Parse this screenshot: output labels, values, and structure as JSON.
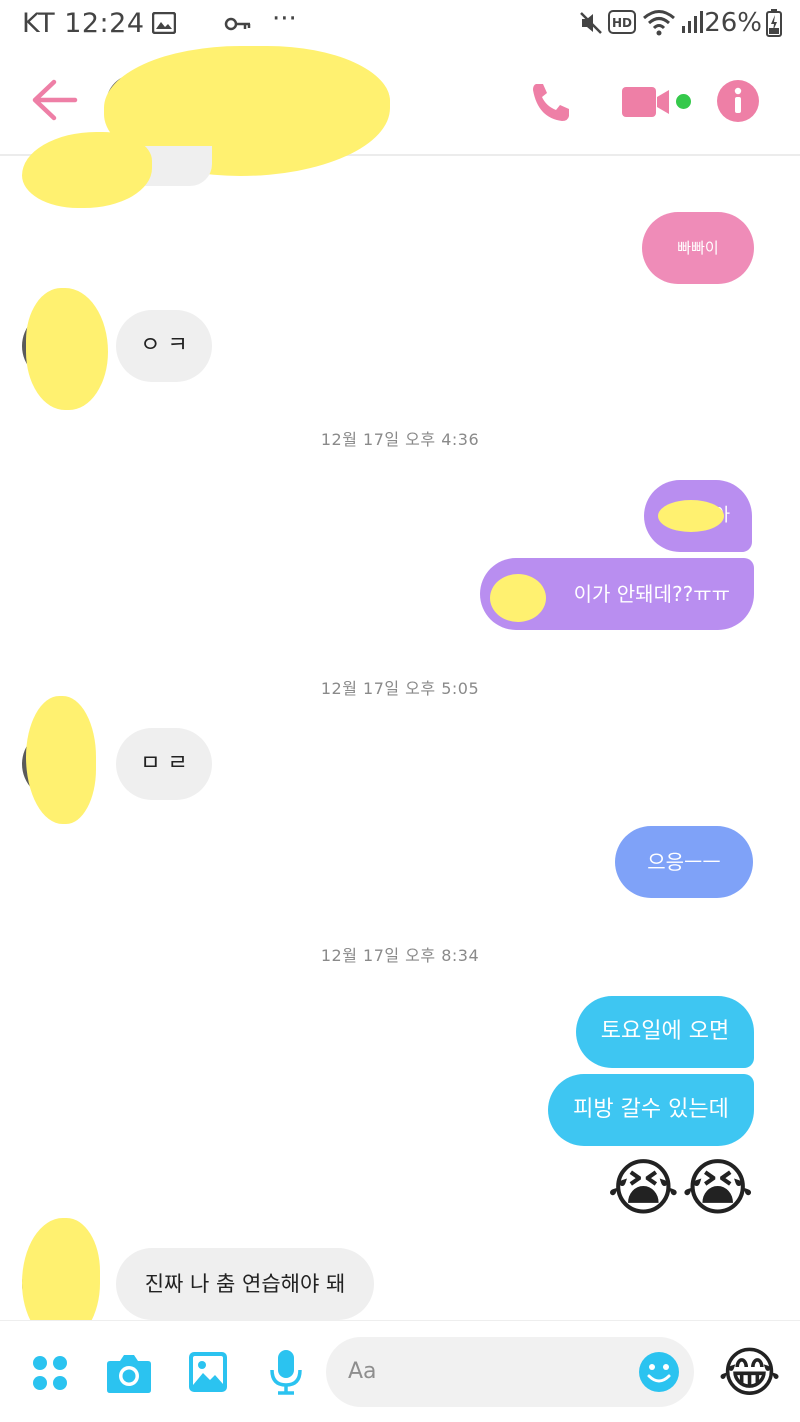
{
  "status_bar": {
    "carrier": "KT",
    "time": "12:24",
    "overflow": "···",
    "battery": "26%",
    "icons": [
      "image-icon",
      "key-icon",
      "mute-icon",
      "hd-icon",
      "wifi-icon",
      "signal-icon",
      "battery-icon"
    ]
  },
  "header": {
    "contact_name": "",
    "icons": [
      "back-arrow-icon",
      "phone-icon",
      "video-icon",
      "info-icon"
    ],
    "online": true
  },
  "colors": {
    "accent_pink": "#ee7fa6",
    "bubble_pink": "#ef8cb8",
    "bubble_purple": "#b98ef0",
    "bubble_periwinkle": "#7fa2f8",
    "bubble_cyan": "#3ec6f2",
    "icon_cyan": "#2bc3f0",
    "online_green": "#35c94b",
    "incoming_bubble": "#efefef"
  },
  "messages": [
    {
      "id": "m1",
      "from": "me",
      "text": "빠빠이"
    },
    {
      "id": "m2",
      "from": "them",
      "text": "ㅇ ㅋ"
    },
    {
      "id": "t1",
      "type": "timestamp",
      "text": "12월 17일 오후 4:36"
    },
    {
      "id": "m3",
      "from": "me",
      "text": "아"
    },
    {
      "id": "m4",
      "from": "me",
      "text": "이가 안돼데??ㅠㅠ"
    },
    {
      "id": "t2",
      "type": "timestamp",
      "text": "12월 17일 오후 5:05"
    },
    {
      "id": "m5",
      "from": "them",
      "text": "ㅁ ㄹ"
    },
    {
      "id": "m6",
      "from": "me",
      "text": "으응ㅡㅡ"
    },
    {
      "id": "t3",
      "type": "timestamp",
      "text": "12월 17일 오후 8:34"
    },
    {
      "id": "m7",
      "from": "me",
      "text": "토요일에 오면"
    },
    {
      "id": "m8",
      "from": "me",
      "text": "피방 갈수 있는데"
    },
    {
      "id": "m9",
      "from": "me",
      "text": "😭😭",
      "type": "emoji"
    },
    {
      "id": "m10",
      "from": "them",
      "text": "진짜 나 춤 연습해야 돼"
    }
  ],
  "composer": {
    "placeholder": "Aa",
    "quick_reaction": "😂",
    "icons": [
      "menu-dots-icon",
      "camera-icon",
      "gallery-icon",
      "mic-icon",
      "emoji-icon"
    ]
  }
}
